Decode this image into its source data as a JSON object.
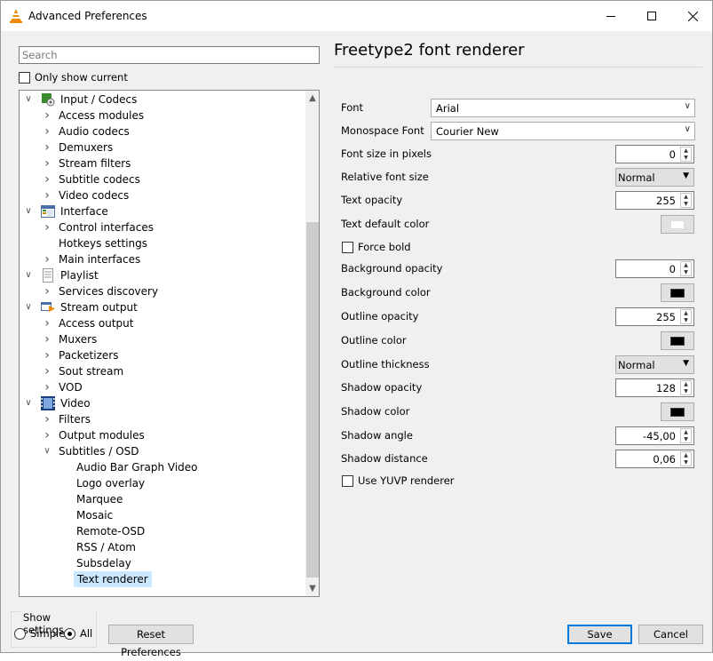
{
  "window": {
    "title": "Advanced Preferences"
  },
  "titlebar": {
    "minimize": "─",
    "maximize": "☐",
    "close": "✕"
  },
  "search": {
    "placeholder": "Search",
    "value": ""
  },
  "only_show_current": {
    "label": "Only show current",
    "checked": false
  },
  "tree": [
    {
      "label": "Input / Codecs",
      "level": 0,
      "expanded": true,
      "icon": "codecs-icon"
    },
    {
      "label": "Access modules",
      "level": 1,
      "expander": true
    },
    {
      "label": "Audio codecs",
      "level": 1,
      "expander": true
    },
    {
      "label": "Demuxers",
      "level": 1,
      "expander": true
    },
    {
      "label": "Stream filters",
      "level": 1,
      "expander": true
    },
    {
      "label": "Subtitle codecs",
      "level": 1,
      "expander": true
    },
    {
      "label": "Video codecs",
      "level": 1,
      "expander": true
    },
    {
      "label": "Interface",
      "level": 0,
      "expanded": true,
      "icon": "interface-icon"
    },
    {
      "label": "Control interfaces",
      "level": 1,
      "expander": true
    },
    {
      "label": "Hotkeys settings",
      "level": 1,
      "expander": false
    },
    {
      "label": "Main interfaces",
      "level": 1,
      "expander": true
    },
    {
      "label": "Playlist",
      "level": 0,
      "expanded": true,
      "icon": "playlist-icon"
    },
    {
      "label": "Services discovery",
      "level": 1,
      "expander": true
    },
    {
      "label": "Stream output",
      "level": 0,
      "expanded": true,
      "icon": "stream-output-icon"
    },
    {
      "label": "Access output",
      "level": 1,
      "expander": true
    },
    {
      "label": "Muxers",
      "level": 1,
      "expander": true
    },
    {
      "label": "Packetizers",
      "level": 1,
      "expander": true
    },
    {
      "label": "Sout stream",
      "level": 1,
      "expander": true
    },
    {
      "label": "VOD",
      "level": 1,
      "expander": true
    },
    {
      "label": "Video",
      "level": 0,
      "expanded": true,
      "icon": "video-icon"
    },
    {
      "label": "Filters",
      "level": 1,
      "expander": true
    },
    {
      "label": "Output modules",
      "level": 1,
      "expander": true
    },
    {
      "label": "Subtitles / OSD",
      "level": 1,
      "expander": true,
      "expanded": true
    },
    {
      "label": "Audio Bar Graph Video",
      "level": 2
    },
    {
      "label": "Logo overlay",
      "level": 2
    },
    {
      "label": "Marquee",
      "level": 2
    },
    {
      "label": "Mosaic",
      "level": 2
    },
    {
      "label": "Remote-OSD",
      "level": 2
    },
    {
      "label": "RSS / Atom",
      "level": 2
    },
    {
      "label": "Subsdelay",
      "level": 2
    },
    {
      "label": "Text renderer",
      "level": 2,
      "selected": true
    }
  ],
  "panel": {
    "title": "Freetype2 font renderer",
    "font_label": "Font",
    "font_value": "Arial",
    "mono_label": "Monospace Font",
    "mono_value": "Courier New",
    "size_label": "Font size in pixels",
    "size_value": "0",
    "rel_label": "Relative font size",
    "rel_value": "Normal",
    "opacity_label": "Text opacity",
    "opacity_value": "255",
    "color_label": "Text default color",
    "color_value": "#ffffff",
    "bold_label": "Force bold",
    "bold_checked": false,
    "bg_opacity_label": "Background opacity",
    "bg_opacity_value": "0",
    "bg_color_label": "Background color",
    "bg_color_value": "#000000",
    "outline_opacity_label": "Outline opacity",
    "outline_opacity_value": "255",
    "outline_color_label": "Outline color",
    "outline_color_value": "#000000",
    "outline_thickness_label": "Outline thickness",
    "outline_thickness_value": "Normal",
    "shadow_opacity_label": "Shadow opacity",
    "shadow_opacity_value": "128",
    "shadow_color_label": "Shadow color",
    "shadow_color_value": "#000000",
    "shadow_angle_label": "Shadow angle",
    "shadow_angle_value": "-45,00",
    "shadow_distance_label": "Shadow distance",
    "shadow_distance_value": "0,06",
    "yuvp_label": "Use YUVP renderer",
    "yuvp_checked": false
  },
  "show_settings": {
    "title": "Show settings",
    "simple": "Simple",
    "all": "All",
    "selected": "All"
  },
  "buttons": {
    "reset": "Reset Preferences",
    "save": "Save",
    "cancel": "Cancel"
  },
  "colors": {
    "accent": "#0078d7",
    "selection": "#cce8ff"
  }
}
